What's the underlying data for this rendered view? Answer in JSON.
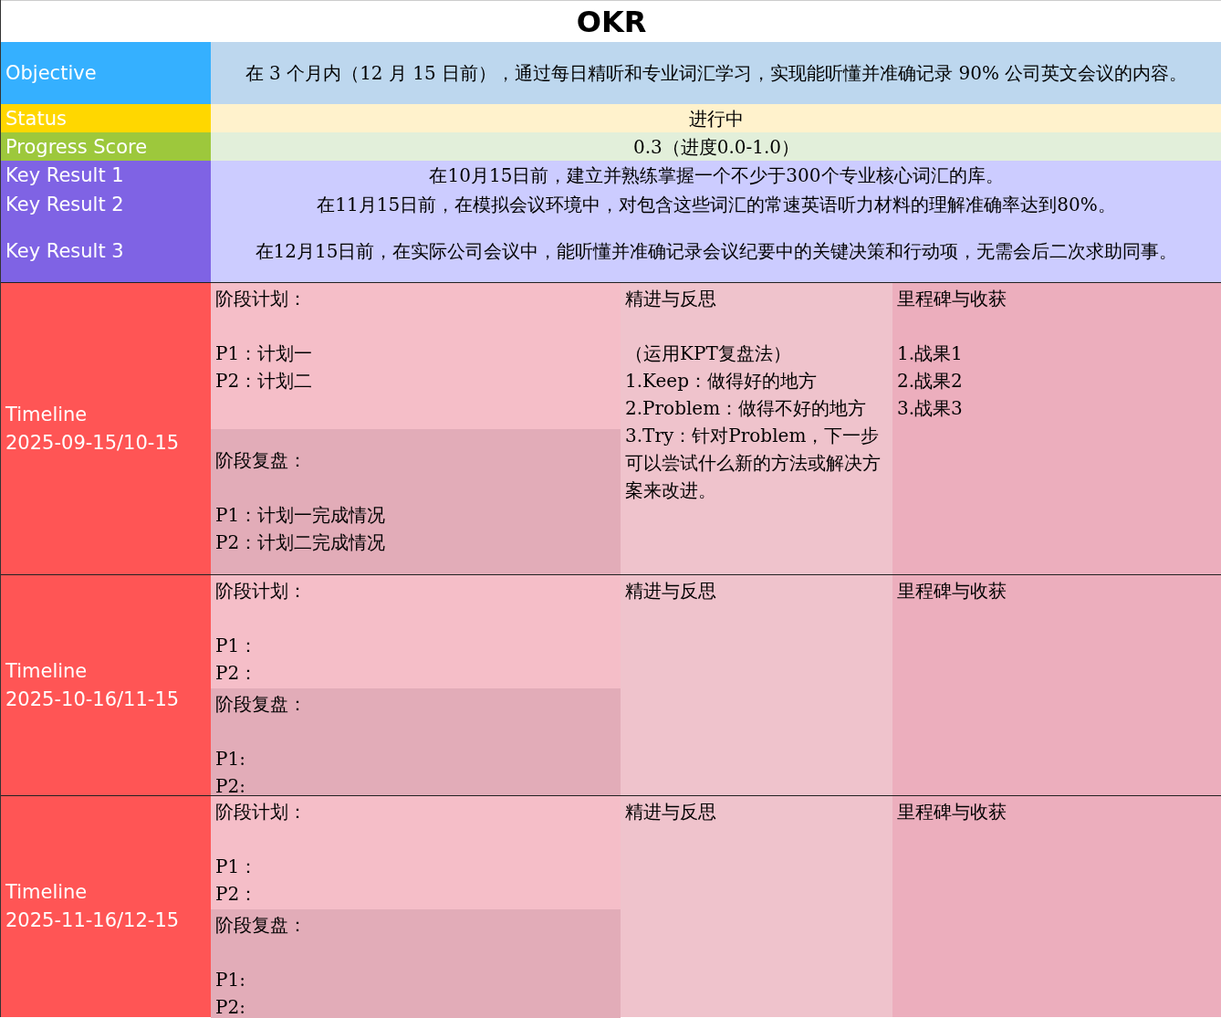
{
  "title": "OKR",
  "objective": {
    "label": "Objective",
    "text": "在 3 个月内（12 月 15 日前），通过每日精听和专业词汇学习，实现能听懂并准确记录 90% 公司英文会议的内容。"
  },
  "status": {
    "label": "Status",
    "text": "进行中"
  },
  "progress": {
    "label": "Progress Score",
    "text": "0.3（进度0.0-1.0）"
  },
  "key_results": [
    {
      "label": "Key Result 1",
      "text": "在10月15日前，建立并熟练掌握一个不少于300个专业核心词汇的库。"
    },
    {
      "label": "Key Result 2",
      "text": "在11月15日前，在模拟会议环境中，对包含这些词汇的常速英语听力材料的理解准确率达到80%。"
    },
    {
      "label": "Key Result 3",
      "text": "在12月15日前，在实际公司会议中，能听懂并准确记录会议纪要中的关键决策和行动项，无需会后二次求助同事。"
    }
  ],
  "timelines": [
    {
      "label": "Timeline",
      "range": "2025-09-15/10-15",
      "plan": {
        "heading": "阶段计划：",
        "items": [
          "P1：计划一",
          "P2：计划二"
        ]
      },
      "review": {
        "heading": "阶段复盘：",
        "items": [
          "P1：计划一完成情况",
          "P2：计划二完成情况"
        ]
      },
      "reflection": {
        "heading": "精进与反思",
        "intro": "（运用KPT复盘法）",
        "items": [
          "1.Keep：做得好的地方",
          "2.Problem：做得不好的地方",
          "3.Try：针对Problem，下一步可以尝试什么新的方法或解决方案来改进。"
        ]
      },
      "milestones": {
        "heading": "里程碑与收获",
        "items": [
          "1.战果1",
          "2.战果2",
          "3.战果3"
        ]
      }
    },
    {
      "label": "Timeline",
      "range": "2025-10-16/11-15",
      "plan": {
        "heading": "阶段计划：",
        "items": [
          "P1：",
          "P2："
        ]
      },
      "review": {
        "heading": "阶段复盘：",
        "items": [
          "P1:",
          "P2:"
        ]
      },
      "reflection": {
        "heading": "精进与反思"
      },
      "milestones": {
        "heading": "里程碑与收获"
      }
    },
    {
      "label": "Timeline",
      "range": "2025-11-16/12-15",
      "plan": {
        "heading": "阶段计划：",
        "items": [
          "P1：",
          "P2："
        ]
      },
      "review": {
        "heading": "阶段复盘：",
        "items": [
          "P1:",
          "P2:"
        ]
      },
      "reflection": {
        "heading": "精进与反思"
      },
      "milestones": {
        "heading": "里程碑与收获"
      }
    }
  ]
}
